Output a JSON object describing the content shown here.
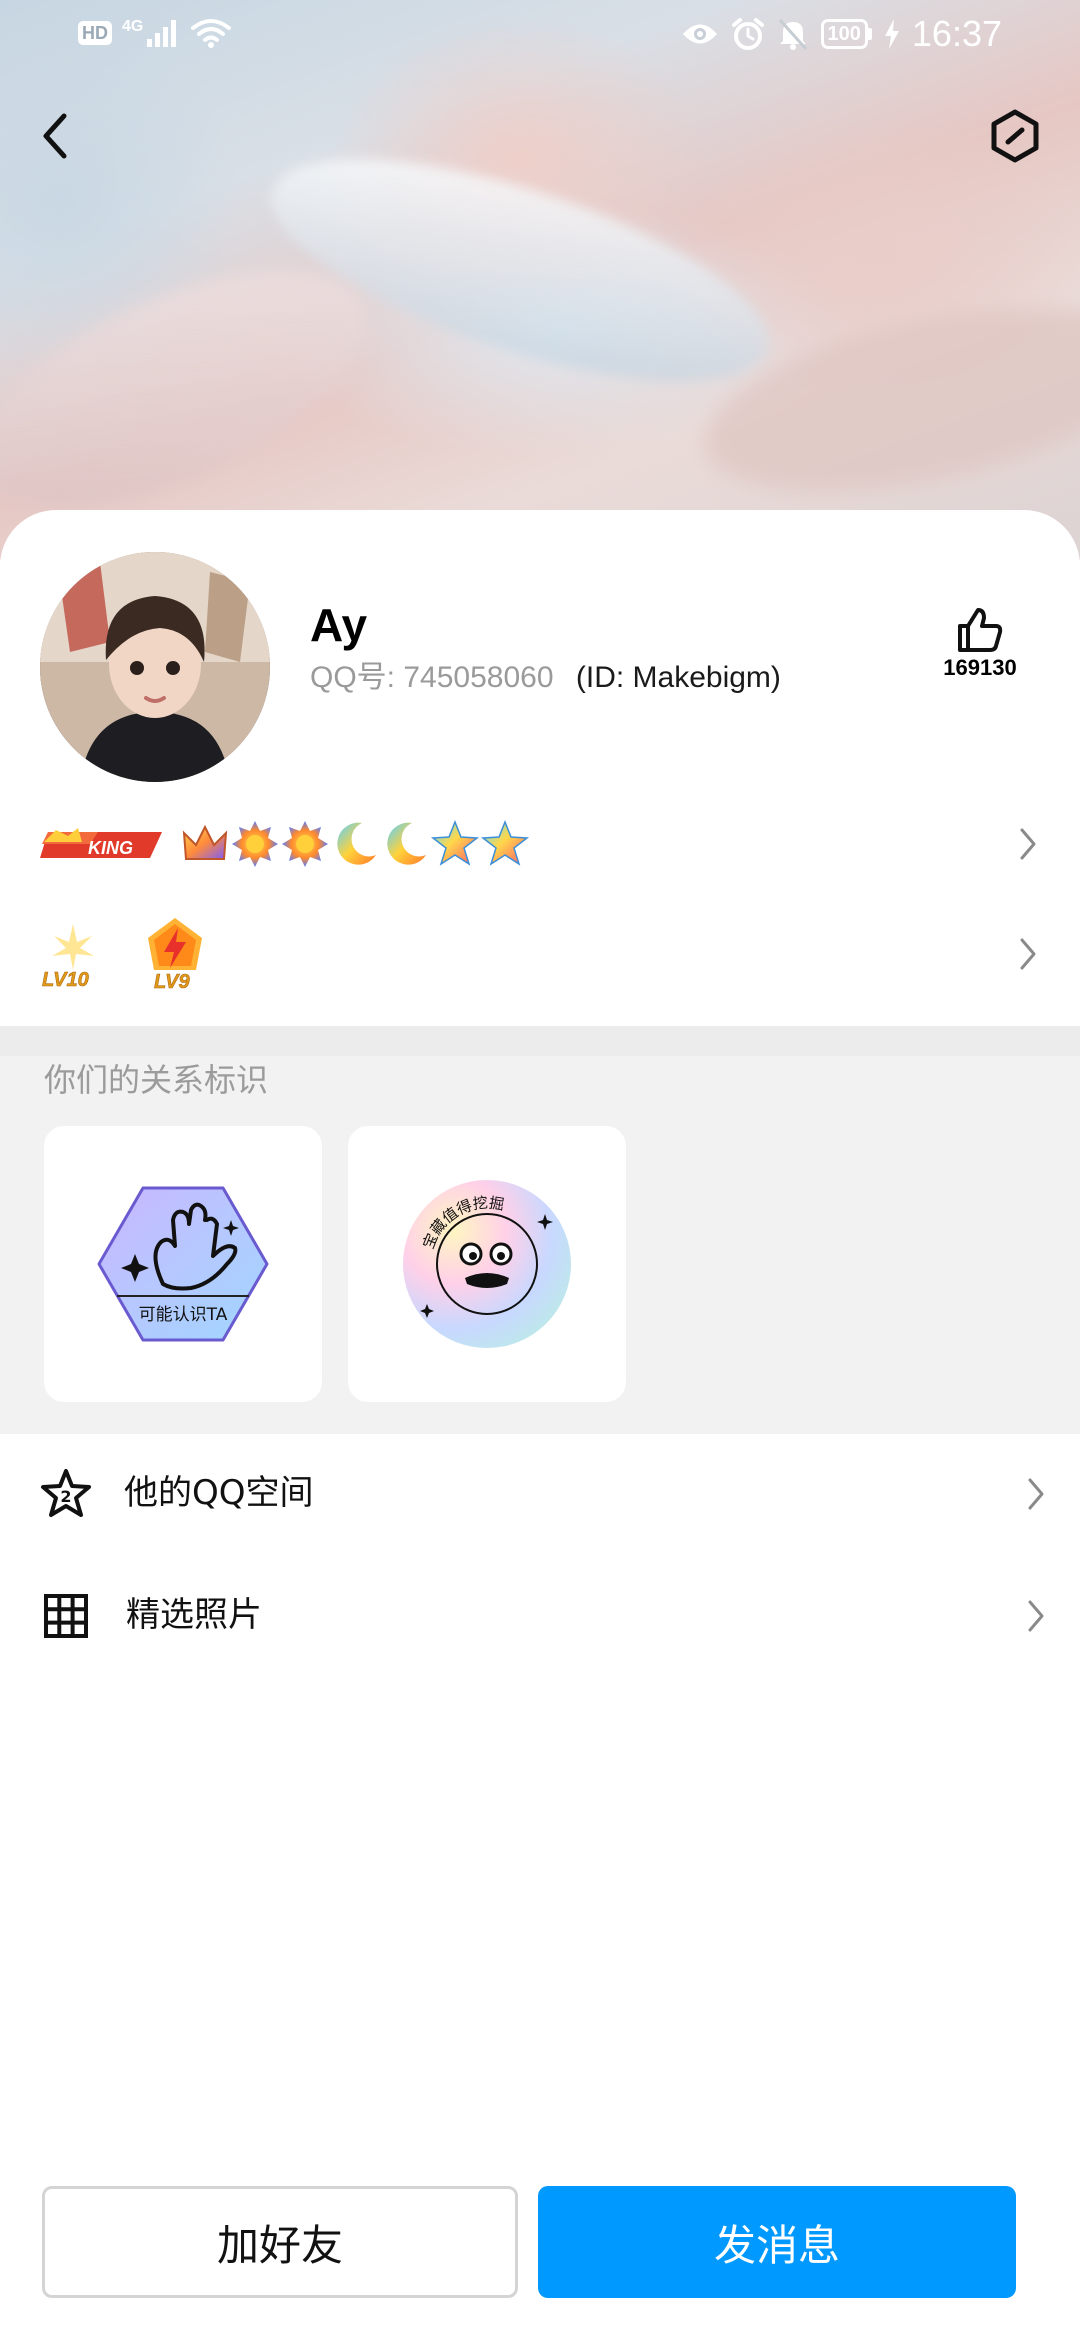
{
  "status_bar": {
    "hd_label": "HD",
    "network_label": "4G",
    "battery_level": "100",
    "time": "16:37",
    "icons": [
      "signal-icon",
      "wifi-icon",
      "eye-icon",
      "alarm-icon",
      "mute-bell-icon",
      "battery-icon",
      "charging-icon"
    ]
  },
  "nav": {
    "back_icon": "back-arrow-icon",
    "settings_icon": "hexagon-icon"
  },
  "profile": {
    "nickname": "Ay",
    "qq_label": "QQ号:",
    "qq_number": "745058060",
    "qq_id": "(ID:  Makebigm)",
    "likes_icon": "thumbs-up-icon",
    "likes_count": "169130"
  },
  "badges": {
    "row1": {
      "king_label": "KING",
      "icons": [
        "crown-icon",
        "sun-icon",
        "sun-icon",
        "moon-icon",
        "moon-icon",
        "star-icon",
        "star-icon"
      ]
    },
    "row2": {
      "levels": [
        "LV10",
        "LV9"
      ]
    }
  },
  "relations": {
    "title": "你们的关系标识",
    "cards": [
      {
        "label": "可能认识TA",
        "icon": "waving-hand-icon"
      },
      {
        "label": "宝藏值得挖掘",
        "icon": "treasure-face-icon"
      }
    ]
  },
  "menu": {
    "items": [
      {
        "label": "他的QQ空间",
        "icon": "qzone-star-icon",
        "badge": "2"
      },
      {
        "label": "精选照片",
        "icon": "photo-grid-icon"
      }
    ]
  },
  "actions": {
    "add_friend": "加好友",
    "send_message": "发消息"
  },
  "colors": {
    "primary": "#0099ff",
    "secondary_text": "#9a9a9a",
    "section_bg": "#f2f2f2"
  }
}
